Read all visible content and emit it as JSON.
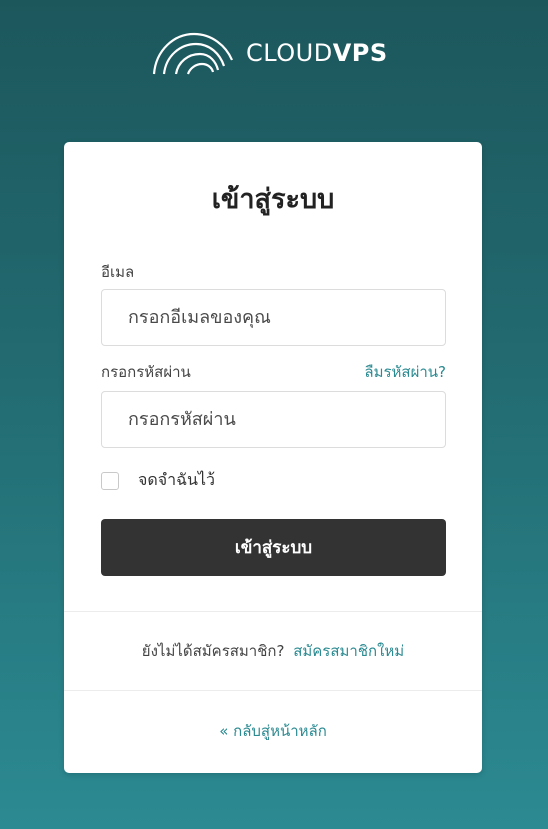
{
  "brand": {
    "logo_icon": "cloud-rings-icon",
    "name_light": "CLOUD",
    "name_bold": "VPS"
  },
  "login": {
    "title": "เข้าสู่ระบบ",
    "email_label": "อีเมล",
    "email_placeholder": "กรอกอีเมลของคุณ",
    "password_label": "กรอกรหัสผ่าน",
    "forgot_link": "ลืมรหัสผ่าน?",
    "password_placeholder": "กรอกรหัสผ่าน",
    "remember_label": "จดจำฉันไว้",
    "remember_checked": false,
    "submit_label": "เข้าสู่ระบบ"
  },
  "signup": {
    "prompt": "ยังไม่ได้สมัครสมาชิก?",
    "link": "สมัครสมาชิกใหม่"
  },
  "back": {
    "icon": "double-chevron-left-icon",
    "link": "« กลับสู่หน้าหลัก"
  },
  "colors": {
    "background_top": "#1c575c",
    "background_bottom": "#2c8a92",
    "link": "#2a8a91",
    "button": "#333333"
  }
}
